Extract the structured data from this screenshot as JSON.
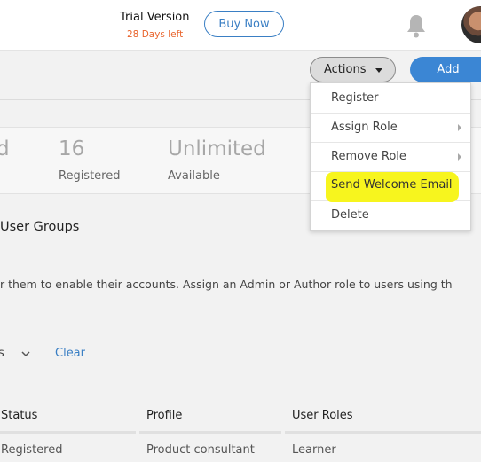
{
  "header": {
    "trial_title": "Trial Version",
    "trial_days": "28 Days left",
    "buy_label": "Buy Now"
  },
  "toolbar": {
    "actions_label": "Actions",
    "add_label": "Add"
  },
  "actions_menu": {
    "items": [
      {
        "label": "Register",
        "has_submenu": false
      },
      {
        "label": "Assign Role",
        "has_submenu": true
      },
      {
        "label": "Remove Role",
        "has_submenu": true
      },
      {
        "label": "Send Welcome Email",
        "has_submenu": false,
        "highlighted": true
      },
      {
        "label": "Delete",
        "has_submenu": false
      }
    ]
  },
  "stats": {
    "partial_value": "d",
    "registered_value": "16",
    "registered_label": "Registered",
    "available_value": "Unlimited",
    "available_label": "Available"
  },
  "section": {
    "title": "User Groups",
    "description": "r them to enable their accounts. Assign an Admin or Author role to users using th"
  },
  "filter": {
    "partial_text": "s",
    "clear_label": "Clear"
  },
  "table": {
    "headers": [
      "Status",
      "Profile",
      "User Roles"
    ],
    "rows": [
      [
        "Registered",
        "Product consultant",
        "Learner"
      ]
    ]
  },
  "colors": {
    "accent": "#3b86d4",
    "trial_orange": "#e8632b",
    "highlight": "#f7f51e"
  }
}
